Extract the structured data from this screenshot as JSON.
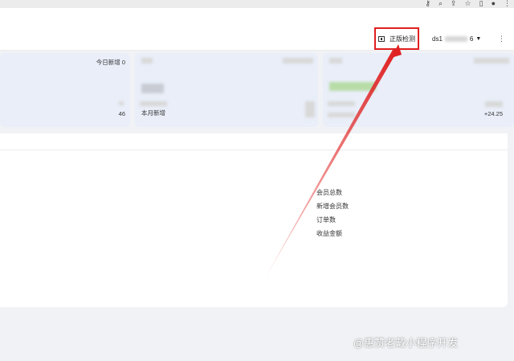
{
  "browser": {
    "icons": [
      "key-icon",
      "zoom-icon",
      "share-icon",
      "star-icon",
      "sidebar-icon",
      "profile-icon",
      "menu-icon"
    ]
  },
  "header": {
    "auth_label": "正版检测",
    "username": "ds1",
    "username_tail": "6"
  },
  "cards": {
    "card1": {
      "today_label": "今日新增 0",
      "count": "46"
    },
    "card2": {
      "month_label": "本月新增"
    },
    "card3": {
      "delta": "+24.25"
    }
  },
  "chart": {
    "legend": [
      "会员总数",
      "新增会员数",
      "订单数",
      "收益金额"
    ]
  },
  "watermark": "@惠赞老戴小程序开发",
  "colors": {
    "highlight": "#e02020",
    "card_bg": "#e9eef8"
  }
}
